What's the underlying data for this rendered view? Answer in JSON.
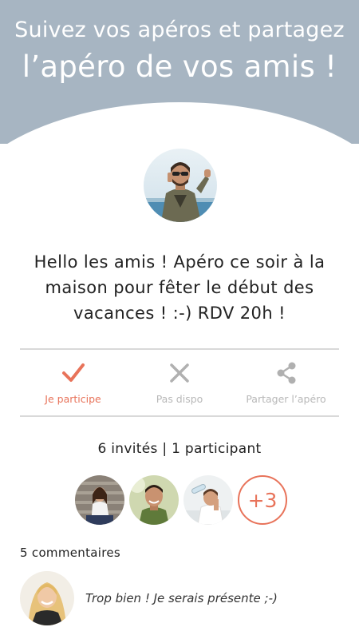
{
  "header": {
    "line1": "Suivez vos apéros et partagez",
    "line2": "l’apéro de vos amis !",
    "background_color": "#a7b5c2"
  },
  "host": {
    "avatar_icon": "host-avatar"
  },
  "message": {
    "line1": "Hello les amis ! Apéro ce soir à la",
    "line2": "maison pour fêter le début des",
    "line3": "vacances ! :-) RDV 20h !"
  },
  "actions": {
    "participate": {
      "label": "Je participe",
      "icon": "check-icon",
      "active": true
    },
    "unavailable": {
      "label": "Pas dispo",
      "icon": "close-icon",
      "active": false
    },
    "share": {
      "label": "Partager l’apéro",
      "icon": "share-icon",
      "active": false
    },
    "accent_color": "#e8735a",
    "inactive_color": "#b8b8b8"
  },
  "guests": {
    "summary": "6 invités | 1 participant",
    "avatars": [
      "guest-avatar-woman-stairs",
      "guest-avatar-man-smiling",
      "guest-avatar-man-drinking"
    ],
    "more_label": "+3"
  },
  "comments": {
    "title": "5 commentaires",
    "items": [
      {
        "avatar": "commenter-avatar-blonde-woman",
        "text": "Trop bien ! Je serais présente ;-)"
      }
    ]
  }
}
